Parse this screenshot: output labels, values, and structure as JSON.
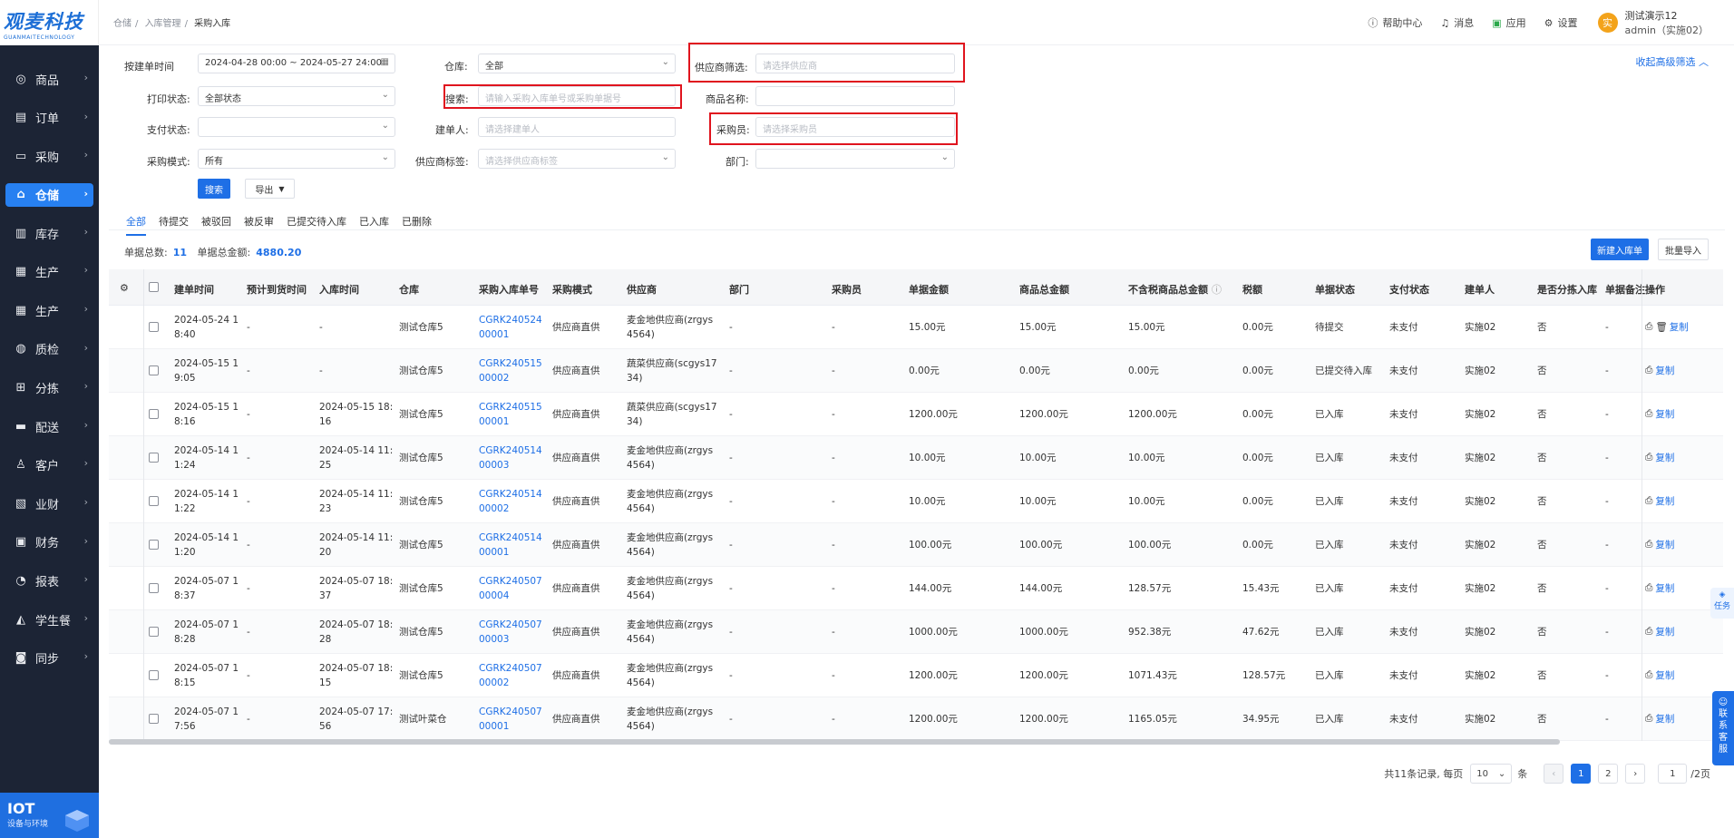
{
  "logo": {
    "title": "观麦科技",
    "sub": "GUANMAITECHNOLOGY"
  },
  "nav": [
    {
      "label": "商品",
      "icon": "goods-icon"
    },
    {
      "label": "订单",
      "icon": "order-icon"
    },
    {
      "label": "采购",
      "icon": "purchase-icon"
    },
    {
      "label": "仓储",
      "icon": "warehouse-icon",
      "active": true
    },
    {
      "label": "库存",
      "icon": "inventory-icon"
    },
    {
      "label": "生产",
      "icon": "production-icon"
    },
    {
      "label": "生产",
      "icon": "production-icon"
    },
    {
      "label": "质检",
      "icon": "quality-icon"
    },
    {
      "label": "分拣",
      "icon": "sorting-icon"
    },
    {
      "label": "配送",
      "icon": "delivery-icon"
    },
    {
      "label": "客户",
      "icon": "customer-icon"
    },
    {
      "label": "业财",
      "icon": "business-finance-icon"
    },
    {
      "label": "财务",
      "icon": "finance-icon"
    },
    {
      "label": "报表",
      "icon": "report-icon"
    },
    {
      "label": "学生餐",
      "icon": "student-meal-icon"
    },
    {
      "label": "同步",
      "icon": "sync-icon"
    }
  ],
  "iot": {
    "title": "IOT",
    "sub": "设备与环境"
  },
  "breadcrumb": [
    "仓储",
    "入库管理",
    "采购入库"
  ],
  "header": {
    "help": "帮助中心",
    "messages": "消息",
    "apps": "应用",
    "settings": "设置",
    "avatar": "实",
    "user_name": "测试演示12",
    "user_account": "admin（实施02）"
  },
  "filters": {
    "date_label": "按建单时间",
    "date_value": "2024-04-28 00:00 ~ 2024-05-27 24:00",
    "warehouse_label": "仓库:",
    "warehouse_value": "全部",
    "supplier_filter_label": "供应商筛选:",
    "supplier_filter_ph": "请选择供应商",
    "print_label": "打印状态:",
    "print_value": "全部状态",
    "search_label": "搜索:",
    "search_ph": "请输入采购入库单号或采购单据号",
    "product_label": "商品名称:",
    "pay_label": "支付状态:",
    "creator_label": "建单人:",
    "creator_ph": "请选择建单人",
    "buyer_label": "采购员:",
    "buyer_ph": "请选择采购员",
    "mode_label": "采购模式:",
    "mode_value": "所有",
    "supplier_tag_label": "供应商标签:",
    "supplier_tag_ph": "请选择供应商标签",
    "dept_label": "部门:",
    "search_btn": "搜索",
    "export_btn": "导出",
    "collapse": "收起高级筛选"
  },
  "tabs": [
    "全部",
    "待提交",
    "被驳回",
    "被反审",
    "已提交待入库",
    "已入库",
    "已删除"
  ],
  "summary": {
    "count_label": "单据总数:",
    "count": "11",
    "amount_label": "单据总金额:",
    "amount": "4880.20"
  },
  "actions": {
    "new": "新建入库单",
    "import": "批量导入"
  },
  "columns": [
    "建单时间",
    "预计到货时间",
    "入库时间",
    "仓库",
    "采购入库单号",
    "采购模式",
    "供应商",
    "部门",
    "采购员",
    "单据金额",
    "商品总金额",
    "不含税商品总金额",
    "税额",
    "单据状态",
    "支付状态",
    "建单人",
    "是否分拣入库",
    "单据备注",
    "操作"
  ],
  "rows": [
    {
      "created": "2024-05-24 1\n8:40",
      "eta": "-",
      "in_time": "-",
      "wh": "测试仓库5",
      "no": "CGRK240524\n00001",
      "mode": "供应商直供",
      "supplier": "麦金地供应商(zrgys\n4564)",
      "dept": "-",
      "buyer": "-",
      "amount": "15.00元",
      "goods": "15.00元",
      "notax": "15.00元",
      "tax": "0.00元",
      "status": "待提交",
      "pay": "未支付",
      "creator": "实施02",
      "sort": "否",
      "remark": "-",
      "op": "复制",
      "del": true
    },
    {
      "created": "2024-05-15 1\n9:05",
      "eta": "-",
      "in_time": "-",
      "wh": "测试仓库5",
      "no": "CGRK240515\n00002",
      "mode": "供应商直供",
      "supplier": "蔬菜供应商(scgys17\n34)",
      "dept": "-",
      "buyer": "-",
      "amount": "0.00元",
      "goods": "0.00元",
      "notax": "0.00元",
      "tax": "0.00元",
      "status": "已提交待入库",
      "pay": "未支付",
      "creator": "实施02",
      "sort": "否",
      "remark": "-",
      "op": "复制"
    },
    {
      "created": "2024-05-15 1\n8:16",
      "eta": "-",
      "in_time": "2024-05-15 18:\n16",
      "wh": "测试仓库5",
      "no": "CGRK240515\n00001",
      "mode": "供应商直供",
      "supplier": "蔬菜供应商(scgys17\n34)",
      "dept": "-",
      "buyer": "-",
      "amount": "1200.00元",
      "goods": "1200.00元",
      "notax": "1200.00元",
      "tax": "0.00元",
      "status": "已入库",
      "pay": "未支付",
      "creator": "实施02",
      "sort": "否",
      "remark": "-",
      "op": "复制"
    },
    {
      "created": "2024-05-14 1\n1:24",
      "eta": "-",
      "in_time": "2024-05-14 11:\n25",
      "wh": "测试仓库5",
      "no": "CGRK240514\n00003",
      "mode": "供应商直供",
      "supplier": "麦金地供应商(zrgys\n4564)",
      "dept": "-",
      "buyer": "-",
      "amount": "10.00元",
      "goods": "10.00元",
      "notax": "10.00元",
      "tax": "0.00元",
      "status": "已入库",
      "pay": "未支付",
      "creator": "实施02",
      "sort": "否",
      "remark": "-",
      "op": "复制"
    },
    {
      "created": "2024-05-14 1\n1:22",
      "eta": "-",
      "in_time": "2024-05-14 11:\n23",
      "wh": "测试仓库5",
      "no": "CGRK240514\n00002",
      "mode": "供应商直供",
      "supplier": "麦金地供应商(zrgys\n4564)",
      "dept": "-",
      "buyer": "-",
      "amount": "10.00元",
      "goods": "10.00元",
      "notax": "10.00元",
      "tax": "0.00元",
      "status": "已入库",
      "pay": "未支付",
      "creator": "实施02",
      "sort": "否",
      "remark": "-",
      "op": "复制"
    },
    {
      "created": "2024-05-14 1\n1:20",
      "eta": "-",
      "in_time": "2024-05-14 11:\n20",
      "wh": "测试仓库5",
      "no": "CGRK240514\n00001",
      "mode": "供应商直供",
      "supplier": "麦金地供应商(zrgys\n4564)",
      "dept": "-",
      "buyer": "-",
      "amount": "100.00元",
      "goods": "100.00元",
      "notax": "100.00元",
      "tax": "0.00元",
      "status": "已入库",
      "pay": "未支付",
      "creator": "实施02",
      "sort": "否",
      "remark": "-",
      "op": "复制"
    },
    {
      "created": "2024-05-07 1\n8:37",
      "eta": "-",
      "in_time": "2024-05-07 18:\n37",
      "wh": "测试仓库5",
      "no": "CGRK240507\n00004",
      "mode": "供应商直供",
      "supplier": "麦金地供应商(zrgys\n4564)",
      "dept": "-",
      "buyer": "-",
      "amount": "144.00元",
      "goods": "144.00元",
      "notax": "128.57元",
      "tax": "15.43元",
      "status": "已入库",
      "pay": "未支付",
      "creator": "实施02",
      "sort": "否",
      "remark": "-",
      "op": "复制"
    },
    {
      "created": "2024-05-07 1\n8:28",
      "eta": "-",
      "in_time": "2024-05-07 18:\n28",
      "wh": "测试仓库5",
      "no": "CGRK240507\n00003",
      "mode": "供应商直供",
      "supplier": "麦金地供应商(zrgys\n4564)",
      "dept": "-",
      "buyer": "-",
      "amount": "1000.00元",
      "goods": "1000.00元",
      "notax": "952.38元",
      "tax": "47.62元",
      "status": "已入库",
      "pay": "未支付",
      "creator": "实施02",
      "sort": "否",
      "remark": "-",
      "op": "复制"
    },
    {
      "created": "2024-05-07 1\n8:15",
      "eta": "-",
      "in_time": "2024-05-07 18:\n15",
      "wh": "测试仓库5",
      "no": "CGRK240507\n00002",
      "mode": "供应商直供",
      "supplier": "麦金地供应商(zrgys\n4564)",
      "dept": "-",
      "buyer": "-",
      "amount": "1200.00元",
      "goods": "1200.00元",
      "notax": "1071.43元",
      "tax": "128.57元",
      "status": "已入库",
      "pay": "未支付",
      "creator": "实施02",
      "sort": "否",
      "remark": "-",
      "op": "复制"
    },
    {
      "created": "2024-05-07 1\n7:56",
      "eta": "-",
      "in_time": "2024-05-07 17:\n56",
      "wh": "测试叶菜仓",
      "no": "CGRK240507\n00001",
      "mode": "供应商直供",
      "supplier": "麦金地供应商(zrgys\n4564)",
      "dept": "-",
      "buyer": "-",
      "amount": "1200.00元",
      "goods": "1200.00元",
      "notax": "1165.05元",
      "tax": "34.95元",
      "status": "已入库",
      "pay": "未支付",
      "creator": "实施02",
      "sort": "否",
      "remark": "-",
      "op": "复制"
    }
  ],
  "pager": {
    "total_text": "共11条记录, 每页",
    "page_size": "10",
    "unit": "条",
    "pages": [
      "1",
      "2"
    ],
    "jump": "1",
    "total_pages": "/2页"
  },
  "float_task": "任务",
  "float_service": "联\n系\n客\n服"
}
